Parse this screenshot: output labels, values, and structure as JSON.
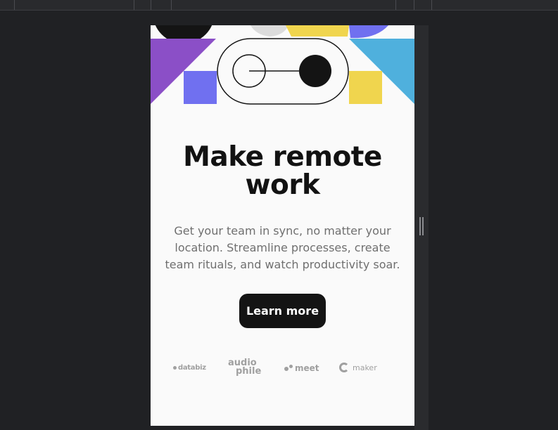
{
  "hero": {
    "title": "Make remote work",
    "description": "Get your team in sync, no matter your location. Streamline processes, create team rituals, and watch productivity soar.",
    "cta_label": "Learn more"
  },
  "clients": {
    "logos": [
      {
        "name": "databiz",
        "text": "databiz"
      },
      {
        "name": "audiophile",
        "line1": "audio",
        "line2": "phile"
      },
      {
        "name": "meet",
        "text": "meet"
      },
      {
        "name": "maker",
        "text": "maker"
      }
    ]
  },
  "colors": {
    "purple": "#8b4fc7",
    "indigo": "#7070f0",
    "cyan": "#4fb0dd",
    "yellow": "#f0d54e",
    "dark": "#141414",
    "background": "#fafafa",
    "text_muted": "#6f6f6f",
    "logo_gray": "#a0a0a0"
  }
}
